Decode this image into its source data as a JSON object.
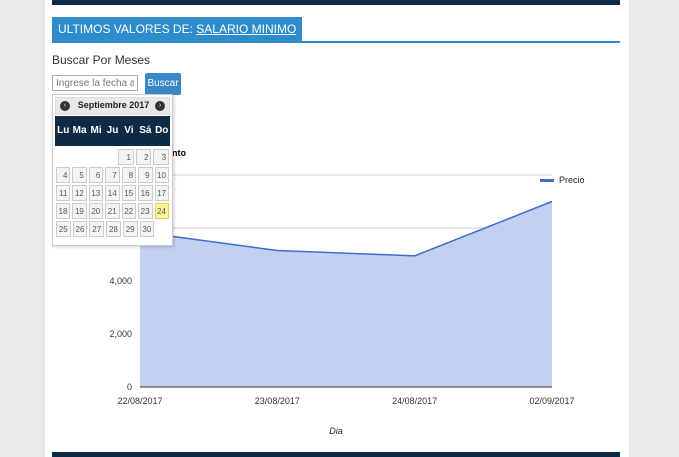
{
  "header": {
    "prefix": "ULTIMOS VALORES DE: ",
    "link": "SALARIO MINIMO"
  },
  "search": {
    "title": "Buscar Por Meses",
    "placeholder": "Ingrese la fecha aquí",
    "button": "Buscar"
  },
  "datepicker": {
    "title": "Septiembre 2017",
    "prev_icon": "chevron-left-icon",
    "next_icon": "chevron-right-icon",
    "weekdays": [
      "Lu",
      "Ma",
      "Mi",
      "Ju",
      "Vi",
      "Sá",
      "Do"
    ],
    "weeks": [
      [
        "",
        "",
        "",
        "",
        "",
        "1",
        "2",
        "3"
      ],
      [
        "4",
        "5",
        "6",
        "7",
        "8",
        "9",
        "10"
      ],
      [
        "11",
        "12",
        "13",
        "14",
        "15",
        "16",
        "17"
      ],
      [
        "18",
        "19",
        "20",
        "21",
        "22",
        "23",
        "24"
      ],
      [
        "25",
        "26",
        "27",
        "28",
        "29",
        "30",
        ""
      ]
    ],
    "highlighted": "24"
  },
  "chart_title_fragment": "nto",
  "chart_data": {
    "type": "area",
    "categories": [
      "22/08/2017",
      "23/08/2017",
      "24/08/2017",
      "02/09/2017"
    ],
    "series": [
      {
        "name": "Precio",
        "values": [
          5850,
          5150,
          4950,
          7000
        ]
      }
    ],
    "ylim": [
      0,
      8000
    ],
    "yticks": [
      "0",
      "2,000",
      "4,000"
    ],
    "xlabel": "Dia",
    "ylabel": "",
    "grid": true,
    "legend": "top-right",
    "colors": {
      "line": "#3f6ccf",
      "fill": "#c2d1f0"
    }
  }
}
